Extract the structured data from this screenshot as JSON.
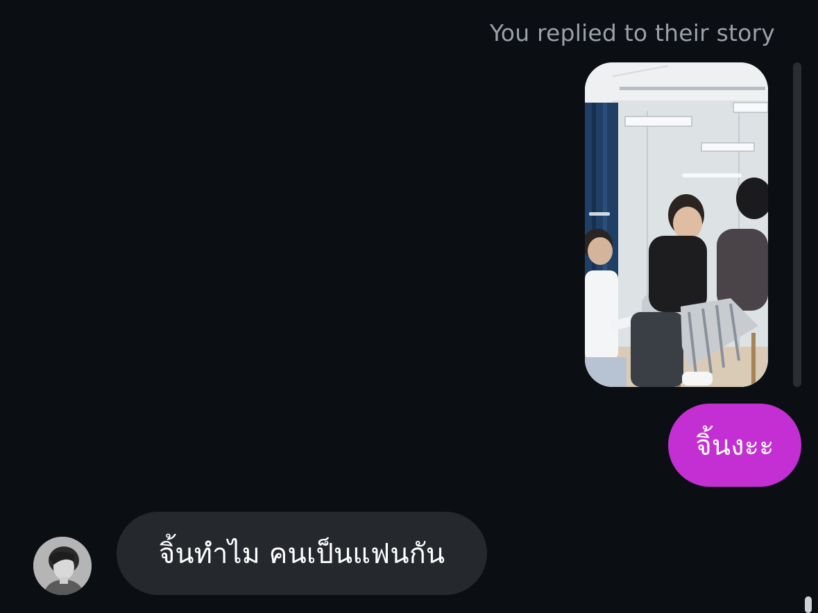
{
  "thread": {
    "context_label": "You replied to their story",
    "story_reply": {
      "image_description_name": "story-photo"
    },
    "sent_message": {
      "text": "จิ้นงะะ",
      "color": "#c32fd3"
    },
    "received_message": {
      "text": "จิ้นทำไม คนเป็นแฟนกัน",
      "color": "#25282d"
    }
  },
  "colors": {
    "background": "#0b0f14",
    "label_text": "#9ca0a7"
  }
}
